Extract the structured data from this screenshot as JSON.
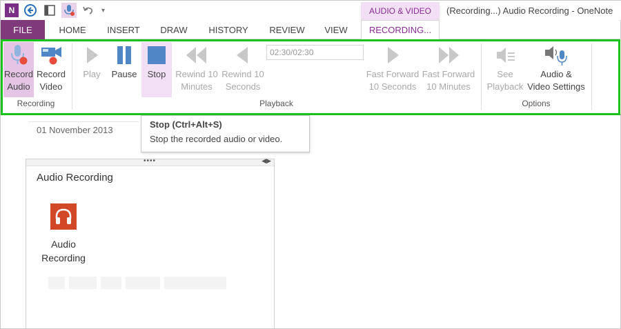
{
  "titlebar": {
    "app_badge": "N",
    "context_group": "AUDIO & VIDEO",
    "window_title": "(Recording...) Audio Recording - OneNote",
    "icons": [
      "onenote-icon",
      "back-icon",
      "dock-icon",
      "record-audio-icon",
      "undo-icon",
      "customize-caret-icon"
    ]
  },
  "tabs": [
    {
      "label": "FILE"
    },
    {
      "label": "HOME"
    },
    {
      "label": "INSERT"
    },
    {
      "label": "DRAW"
    },
    {
      "label": "HISTORY"
    },
    {
      "label": "REVIEW"
    },
    {
      "label": "VIEW"
    },
    {
      "label": "RECORDING..."
    }
  ],
  "ribbon": {
    "groups": {
      "recording": "Recording",
      "playback": "Playback",
      "options": "Options"
    },
    "buttons": {
      "record_audio": "Record\nAudio",
      "record_video": "Record\nVideo",
      "play": "Play",
      "pause": "Pause",
      "stop": "Stop",
      "rewind_10_min": "Rewind 10\nMinutes",
      "rewind_10_sec": "Rewind 10\nSeconds",
      "ff_10_sec": "Fast Forward\n10 Seconds",
      "ff_10_min": "Fast Forward\n10 Minutes",
      "see_playback": "See\nPlayback",
      "av_settings": "Audio &\nVideo Settings"
    },
    "time_display": "02:30/02:30"
  },
  "tooltip": {
    "title": "Stop (Ctrl+Alt+S)",
    "description": "Stop the recorded audio or video."
  },
  "page": {
    "date": "01 November 2013",
    "note_title": "Audio Recording",
    "attachment_name": "Audio\nRecording"
  },
  "colors": {
    "onenote_purple": "#80397b",
    "context_pink": "#f1dff3",
    "highlight_green": "#19c219",
    "media_blue": "#4f86c6",
    "record_red": "#e74c3c",
    "audio_file_orange": "#d24726"
  }
}
